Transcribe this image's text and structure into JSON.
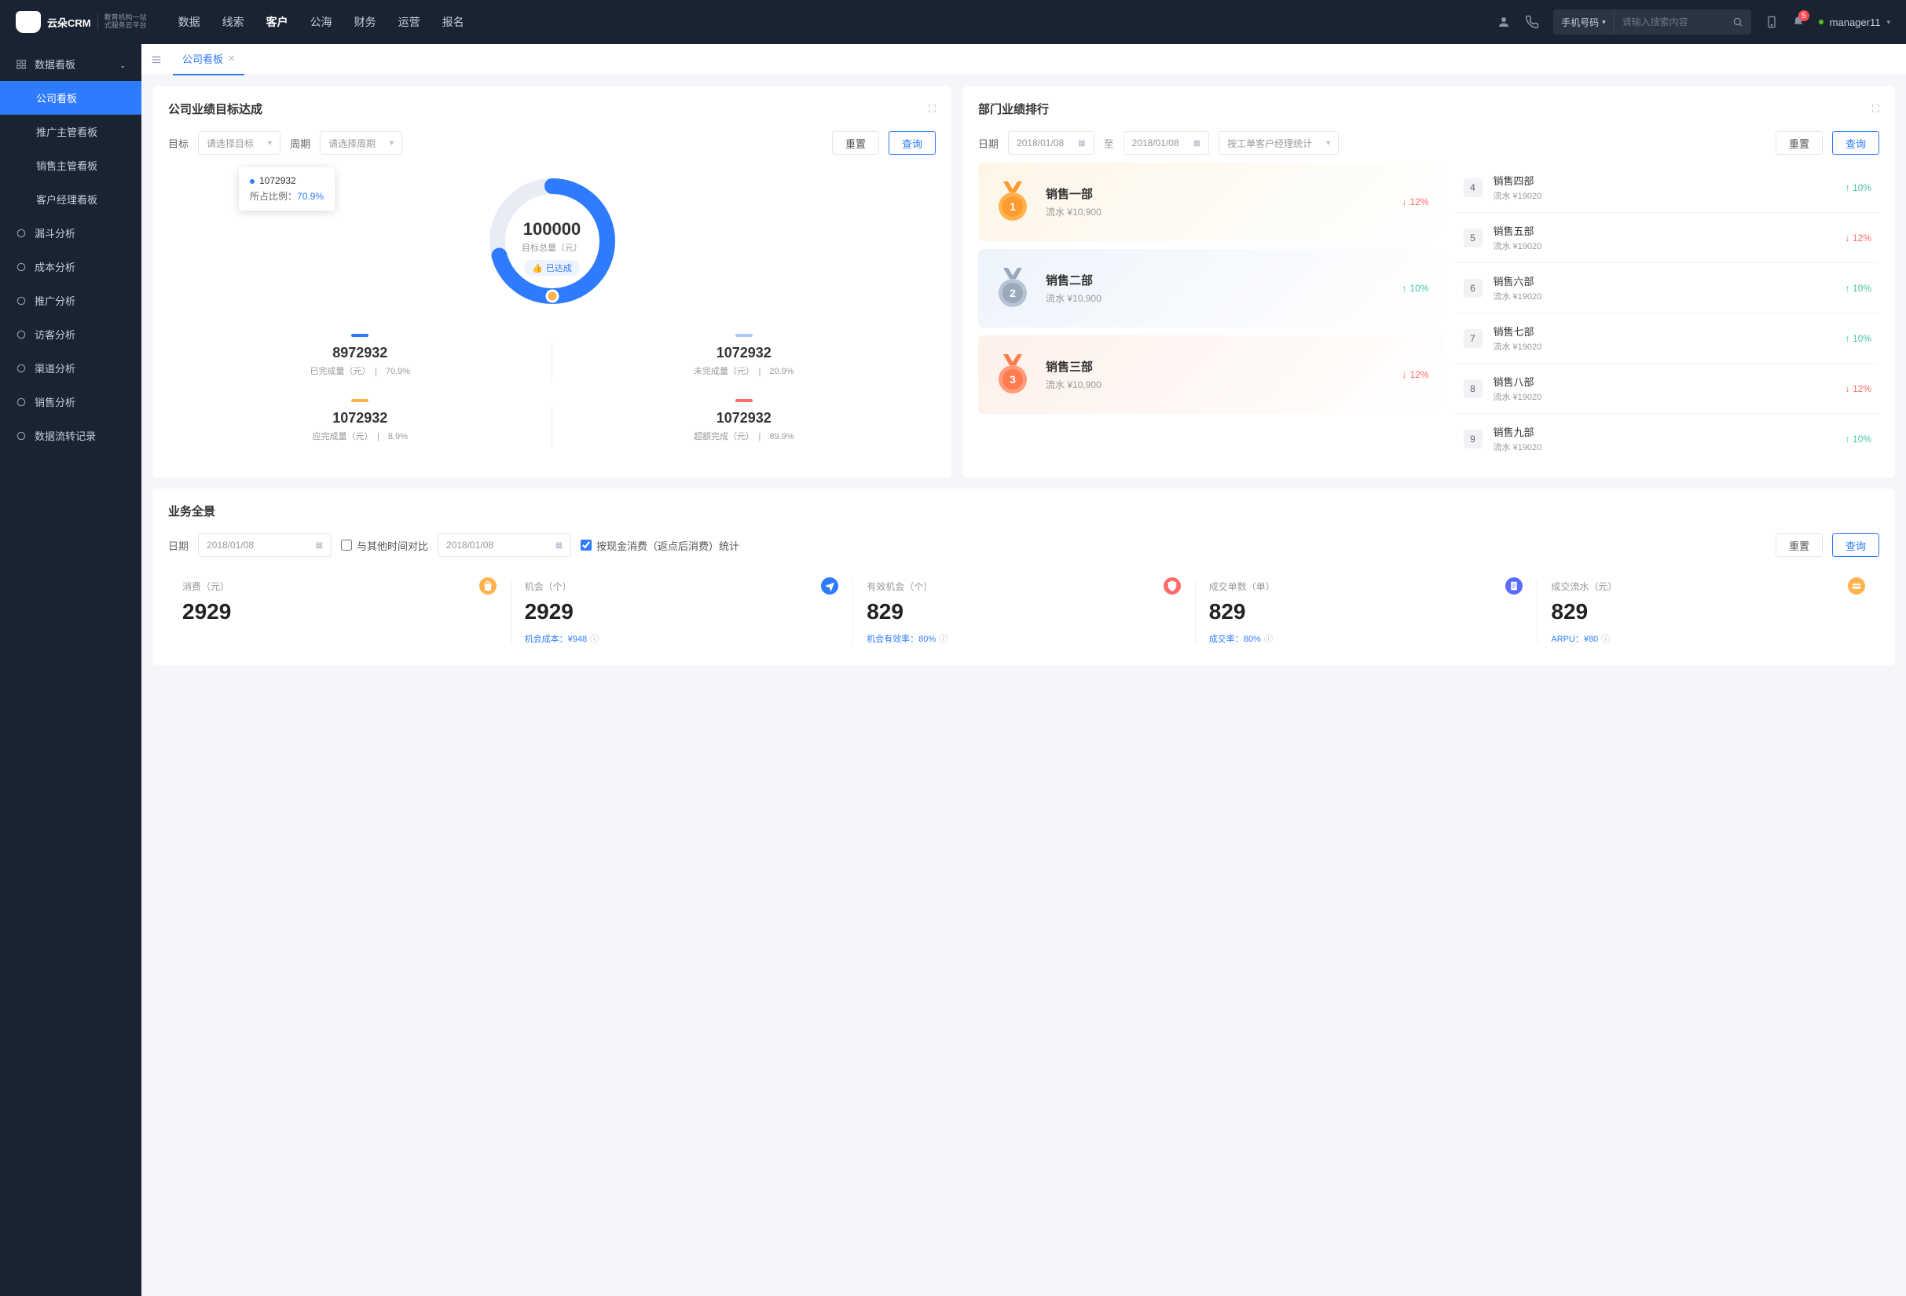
{
  "header": {
    "logo_main": "云朵CRM",
    "logo_sub1": "教育机构一站",
    "logo_sub2": "式服务云平台",
    "nav": [
      "数据",
      "线索",
      "客户",
      "公海",
      "财务",
      "运营",
      "报名"
    ],
    "nav_active": 2,
    "search_type": "手机号码",
    "search_placeholder": "请输入搜索内容",
    "badge_count": "5",
    "user": "manager11"
  },
  "sidebar": {
    "group": "数据看板",
    "subs": [
      "公司看板",
      "推广主管看板",
      "销售主管看板",
      "客户经理看板"
    ],
    "sub_active": 0,
    "items": [
      "漏斗分析",
      "成本分析",
      "推广分析",
      "访客分析",
      "渠道分析",
      "销售分析",
      "数据流转记录"
    ]
  },
  "tab": {
    "label": "公司看板"
  },
  "goal": {
    "title": "公司业绩目标达成",
    "label_target": "目标",
    "ph_target": "请选择目标",
    "label_period": "周期",
    "ph_period": "请选择周期",
    "btn_reset": "重置",
    "btn_query": "查询",
    "tooltip_value": "1072932",
    "tooltip_lbl": "所占比例：",
    "tooltip_pct": "70.9%",
    "center_value": "100000",
    "center_sub": "目标总量（元）",
    "center_tag": "已达成",
    "stats": [
      {
        "bar": "#2f7bff",
        "value": "8972932",
        "label": "已完成量（元）",
        "pct": "70.9%"
      },
      {
        "bar": "#a9c8ff",
        "value": "1072932",
        "label": "未完成量（元）",
        "pct": "20.9%"
      },
      {
        "bar": "#ffb24d",
        "value": "1072932",
        "label": "应完成量（元）",
        "pct": "8.9%"
      },
      {
        "bar": "#ff6b6b",
        "value": "1072932",
        "label": "超额完成（元）",
        "pct": "89.9%"
      }
    ]
  },
  "rank": {
    "title": "部门业绩排行",
    "label_date": "日期",
    "date_from": "2018/01/08",
    "date_sep": "至",
    "date_to": "2018/01/08",
    "stat_type": "按工单客户经理统计",
    "btn_reset": "重置",
    "btn_query": "查询",
    "top3": [
      {
        "rank": "1",
        "name": "销售一部",
        "amount": "流水 ¥10,900",
        "pct": "12%",
        "dir": "down"
      },
      {
        "rank": "2",
        "name": "销售二部",
        "amount": "流水 ¥10,900",
        "pct": "10%",
        "dir": "up"
      },
      {
        "rank": "3",
        "name": "销售三部",
        "amount": "流水 ¥10,900",
        "pct": "12%",
        "dir": "down"
      }
    ],
    "list": [
      {
        "rank": "4",
        "name": "销售四部",
        "amount": "流水 ¥19020",
        "pct": "10%",
        "dir": "up"
      },
      {
        "rank": "5",
        "name": "销售五部",
        "amount": "流水 ¥19020",
        "pct": "12%",
        "dir": "down"
      },
      {
        "rank": "6",
        "name": "销售六部",
        "amount": "流水 ¥19020",
        "pct": "10%",
        "dir": "up"
      },
      {
        "rank": "7",
        "name": "销售七部",
        "amount": "流水 ¥19020",
        "pct": "10%",
        "dir": "up"
      },
      {
        "rank": "8",
        "name": "销售八部",
        "amount": "流水 ¥19020",
        "pct": "12%",
        "dir": "down"
      },
      {
        "rank": "9",
        "name": "销售九部",
        "amount": "流水 ¥19020",
        "pct": "10%",
        "dir": "up"
      }
    ]
  },
  "overview": {
    "title": "业务全景",
    "label_date": "日期",
    "date1": "2018/01/08",
    "compare_label": "与其他时间对比",
    "date2": "2018/01/08",
    "stat_option": "按现金消费（返点后消费）统计",
    "btn_reset": "重置",
    "btn_query": "查询",
    "metrics": [
      {
        "label": "消费（元）",
        "value": "2929",
        "sub": "",
        "icon_bg": "#ffb24d",
        "icon": "bag"
      },
      {
        "label": "机会（个）",
        "value": "2929",
        "sub": "机会成本：¥948",
        "icon_bg": "#2f7bff",
        "icon": "plane"
      },
      {
        "label": "有效机会（个）",
        "value": "829",
        "sub": "机会有效率：80%",
        "icon_bg": "#ff6b6b",
        "icon": "shield"
      },
      {
        "label": "成交单数（单）",
        "value": "829",
        "sub": "成交率：80%",
        "icon_bg": "#5c6cff",
        "icon": "doc"
      },
      {
        "label": "成交流水（元）",
        "value": "829",
        "sub": "ARPU：¥80",
        "icon_bg": "#ffb24d",
        "icon": "card"
      }
    ]
  },
  "chart_data": {
    "type": "pie",
    "title": "公司业绩目标达成",
    "total_label": "目标总量（元）",
    "total": 100000,
    "series": [
      {
        "name": "已完成量（元）",
        "value": 8972932,
        "pct": 70.9,
        "color": "#2f7bff"
      },
      {
        "name": "未完成量（元）",
        "value": 1072932,
        "pct": 20.9,
        "color": "#a9c8ff"
      },
      {
        "name": "应完成量（元）",
        "value": 1072932,
        "pct": 8.9,
        "color": "#ffb24d"
      },
      {
        "name": "超额完成（元）",
        "value": 1072932,
        "pct": 89.9,
        "color": "#ff6b6b"
      }
    ]
  }
}
